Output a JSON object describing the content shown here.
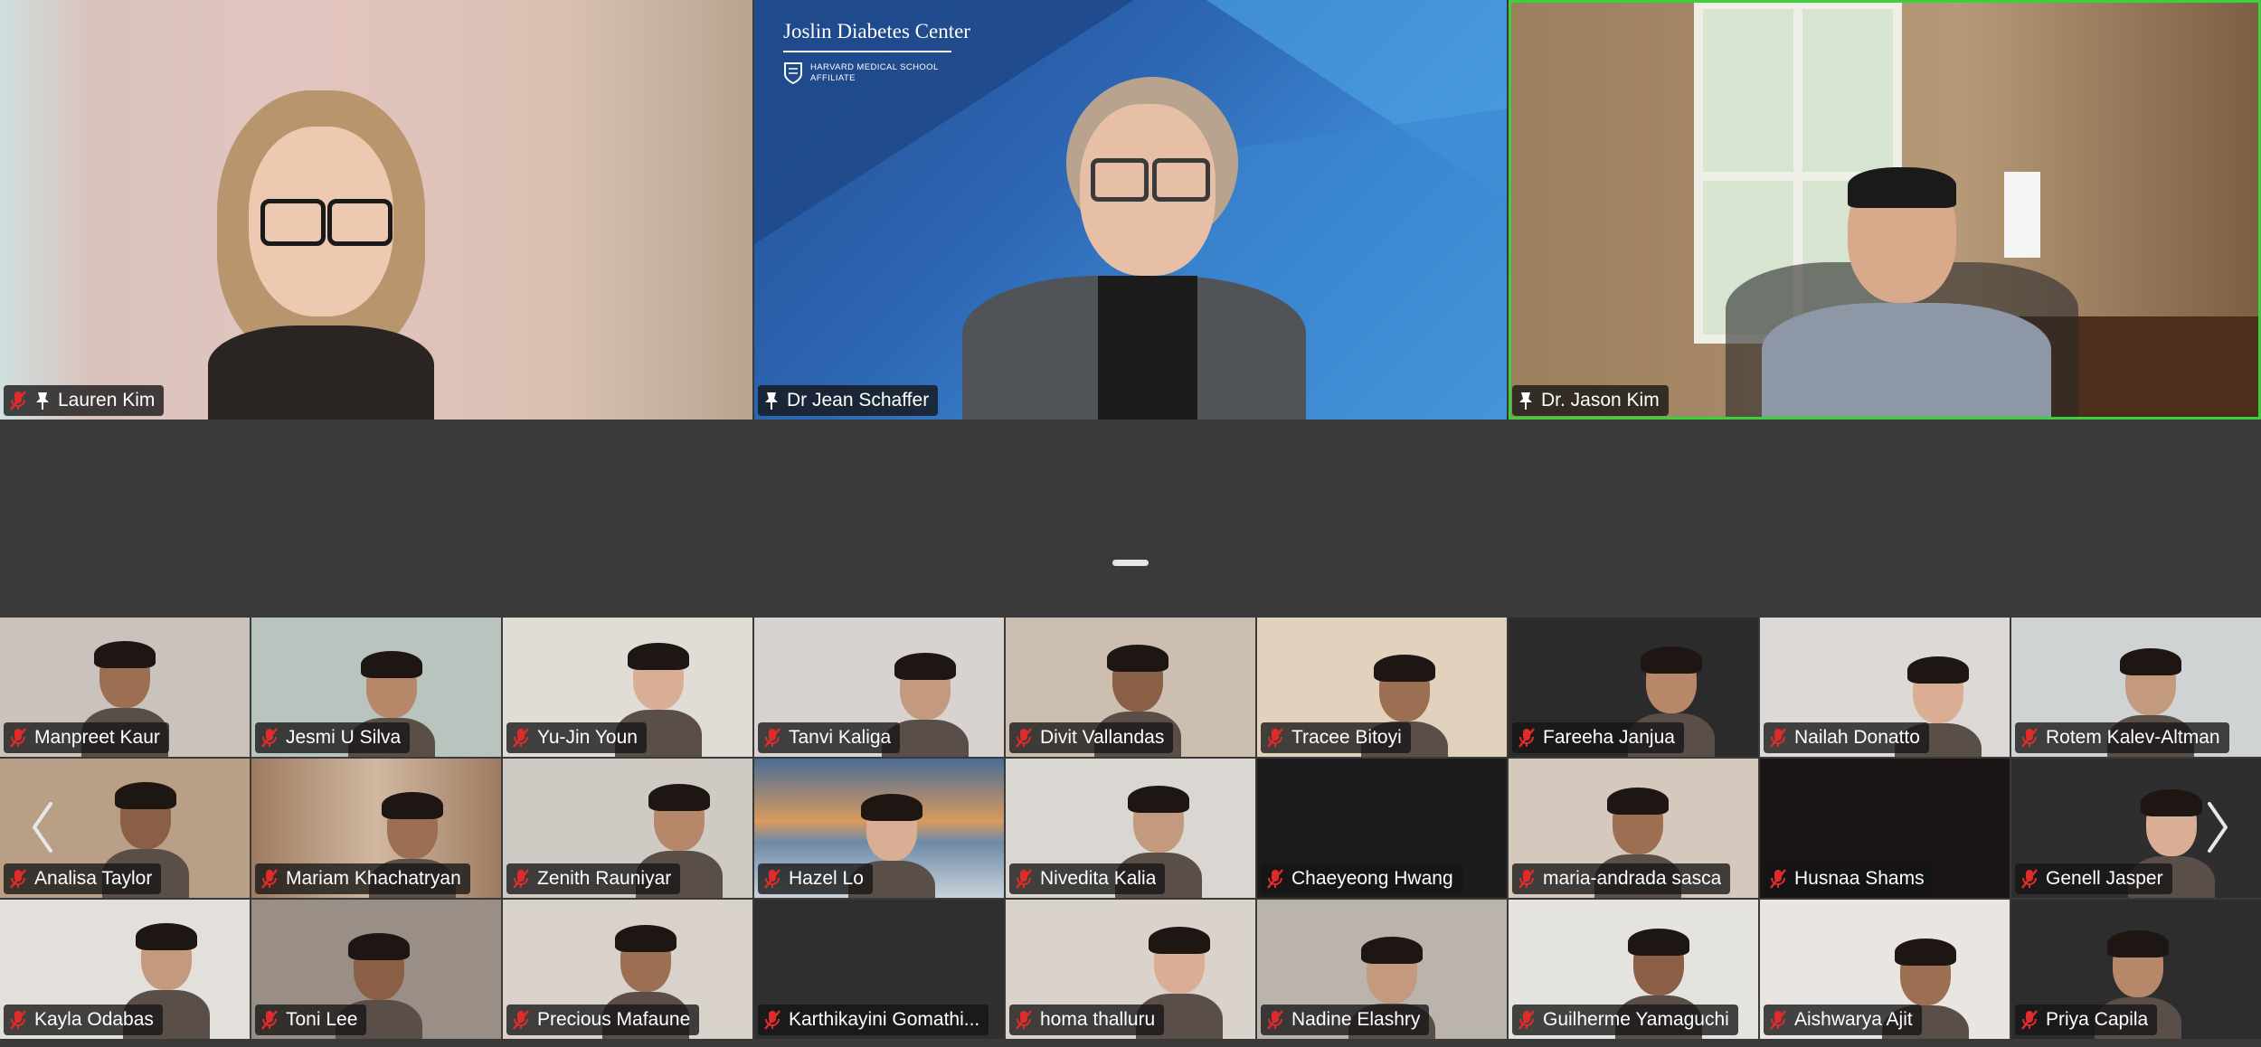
{
  "speakers": [
    {
      "name": "Lauren Kim",
      "muted": true,
      "pinned": true
    },
    {
      "name": "Dr Jean Schaffer",
      "muted": false,
      "pinned": true
    },
    {
      "name": "Dr. Jason Kim",
      "muted": false,
      "pinned": true,
      "active_speaker": true
    }
  ],
  "background": {
    "org_name": "Joslin Diabetes Center",
    "affiliate_line1": "HARVARD MEDICAL SCHOOL",
    "affiliate_line2": "AFFILIATE"
  },
  "gallery": {
    "rows": [
      [
        "Manpreet Kaur",
        "Jesmi U Silva",
        "Yu-Jin Youn",
        "Tanvi Kaliga",
        "Divit Vallandas",
        "Tracee Bitoyi",
        "Fareeha  Janjua",
        "Nailah Donatto",
        "Rotem Kalev-Altman"
      ],
      [
        "Analisa Taylor",
        "Mariam Khachatryan",
        "Zenith Rauniyar",
        "Hazel Lo",
        "Nivedita Kalia",
        "Chaeyeong Hwang",
        "maria-andrada sasca",
        "Husnaa Shams",
        "Genell Jasper"
      ],
      [
        "Kayla Odabas",
        "Toni Lee",
        "Precious Mafaune",
        "Karthikayini Gomathi...",
        "homa thalluru",
        "Nadine Elashry",
        "Guilherme Yamaguchi",
        "Aishwarya Ajit",
        "Priya Capila"
      ]
    ]
  },
  "nav": {
    "prev_icon": "chevron-left-icon",
    "next_icon": "chevron-right-icon"
  },
  "colors": {
    "speaker_highlight": "#3dcf3d",
    "mute_red": "#e02b2b",
    "stage_bg": "#3a3a3a"
  }
}
